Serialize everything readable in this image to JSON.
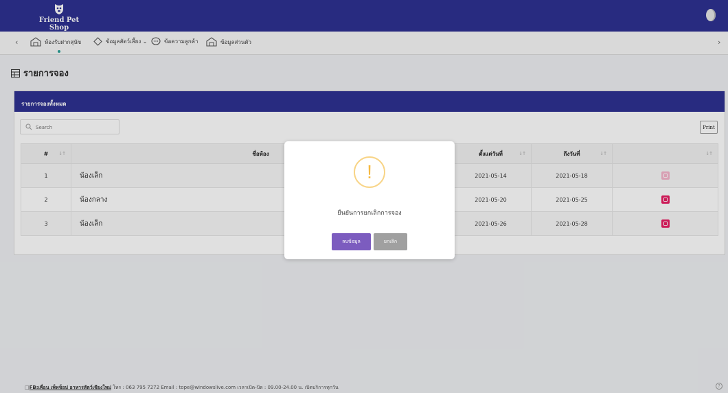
{
  "header": {
    "logo_text": "Friend Pet Shop",
    "avatar": "user-avatar"
  },
  "nav": {
    "prev_arrow": "‹",
    "next_arrow": "›",
    "items": [
      {
        "label": "ห้องรับฝากสุนัข",
        "icon": "room-icon"
      },
      {
        "label": "ข้อมูลสัตว์เลี้ยง ⌄",
        "icon": "diamond-icon"
      },
      {
        "label": "ข้อความลูกค้า",
        "icon": "chat-icon"
      },
      {
        "label": "ข้อมูลส่วนตัว",
        "icon": "room-icon"
      }
    ]
  },
  "page": {
    "title": "รายการจอง"
  },
  "card": {
    "header": "รายการจองทั้งหมด",
    "search_placeholder": "Search",
    "print_label": "Print"
  },
  "table": {
    "columns": [
      "#",
      "ชื่อห้อง",
      "ตั้งแต่วันที่",
      "ถึงวันที่",
      ""
    ],
    "rows": [
      {
        "num": "1",
        "room": "น้องเล็ก",
        "from": "2021-05-14",
        "to": "2021-05-18",
        "delete_disabled": true
      },
      {
        "num": "2",
        "room": "น้องกลาง",
        "from": "2021-05-20",
        "to": "2021-05-25",
        "delete_disabled": false
      },
      {
        "num": "3",
        "room": "น้องเล็ก",
        "from": "2021-05-26",
        "to": "2021-05-28",
        "delete_disabled": false
      }
    ]
  },
  "modal": {
    "icon": "!",
    "message": "ยืนยันการยกเลิกการจอง",
    "confirm_label": "ลบข้อมูล",
    "cancel_label": "ยกเลิก"
  },
  "footer": {
    "prefix": "□",
    "link_text": "FB:เพื่อน เพ็ทช็อป อาหารสัตว์เชียงใหม่",
    "info": "  โทร : 063 795 7272   Email : tope@windowslive.com   เวลาเปิด-ปิด : 09.00-24.00 น. เปิดบริการทุกวัน",
    "help_icon": "?"
  },
  "colors": {
    "primary": "#2e3192",
    "confirm": "#7c5cbf",
    "cancel": "#a0a0a0",
    "delete": "#e91e63",
    "warning": "#f5b942"
  }
}
